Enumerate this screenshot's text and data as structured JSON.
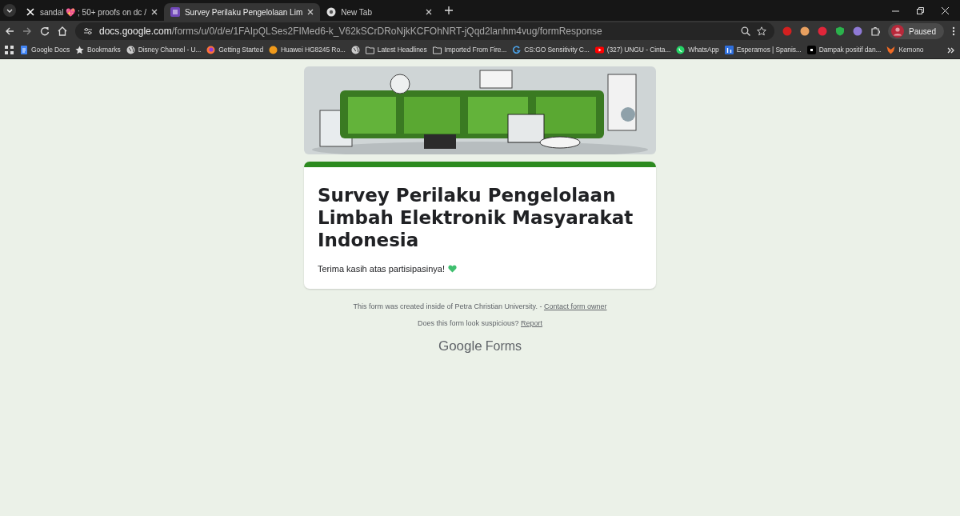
{
  "tabs": [
    {
      "label": "sandal 💖 ; 50+ proofs on dc /",
      "selected": false
    },
    {
      "label": "Survey Perilaku Pengelolaan Lim",
      "selected": true
    },
    {
      "label": "New Tab",
      "selected": false
    }
  ],
  "address": {
    "domain": "docs.google.com",
    "path": "/forms/u/0/d/e/1FAIpQLSes2FIMed6-k_V62kSCrDRoNjkKCFOhNRT-jQqd2lanhm4vug/formResponse"
  },
  "profile": {
    "label": "Paused"
  },
  "bookmarks": [
    {
      "label": "Google Docs"
    },
    {
      "label": "Bookmarks"
    },
    {
      "label": "Disney Channel - U..."
    },
    {
      "label": "Getting Started"
    },
    {
      "label": "Huawei HG8245 Ro..."
    },
    {
      "label": "Latest Headlines"
    },
    {
      "label": "Imported From Fire..."
    },
    {
      "label": "CS:GO Sensitivity C..."
    },
    {
      "label": "(327) UNGU - Cinta..."
    },
    {
      "label": "WhatsApp"
    },
    {
      "label": "Esperamos | Spanis..."
    },
    {
      "label": "Dampak positif dan..."
    },
    {
      "label": "Kemono"
    }
  ],
  "form": {
    "title": "Survey Perilaku Pengelolaan Limbah Elektronik Masyarakat Indonesia",
    "message": "Terima kasih atas partisipasinya!"
  },
  "footer": {
    "created_text": "This form was created inside of Petra Christian University. -",
    "contact_link": "Contact form owner",
    "suspicious_text": "Does this form look suspicious?",
    "report_link": "Report",
    "logo_google": "Google",
    "logo_forms": "Forms"
  }
}
